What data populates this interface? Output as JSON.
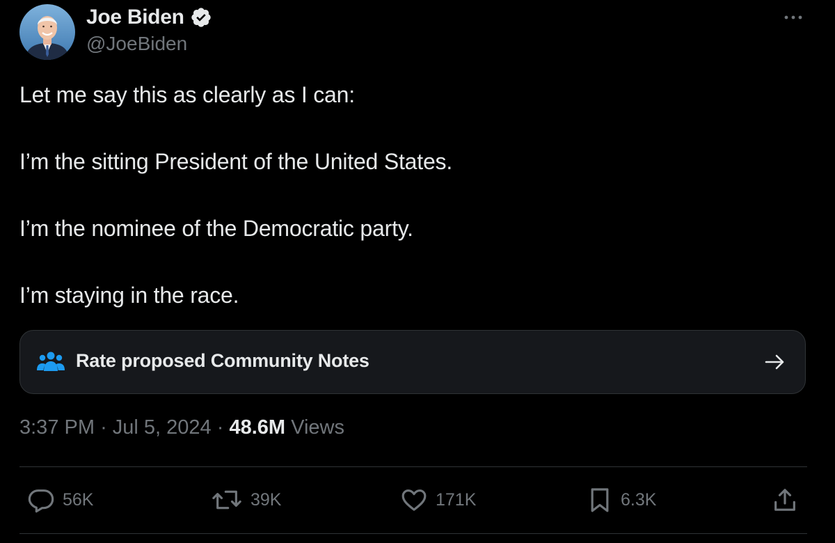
{
  "author": {
    "display_name": "Joe Biden",
    "handle": "@JoeBiden",
    "verified_icon": "verified-badge-icon",
    "avatar_icon": "avatar"
  },
  "tweet": {
    "paragraphs": [
      "Let me say this as clearly as I can:",
      "I’m the sitting President of the United States.",
      "I’m the nominee of the Democratic party.",
      "I’m staying in the race."
    ]
  },
  "community_notes": {
    "label": "Rate proposed Community Notes",
    "icon": "community-notes-icon",
    "arrow_icon": "arrow-right-icon"
  },
  "meta": {
    "time": "3:37 PM",
    "separator": "·",
    "date": "Jul 5, 2024",
    "views_count": "48.6M",
    "views_label": "Views"
  },
  "actions": {
    "replies": "56K",
    "reposts": "39K",
    "likes": "171K",
    "bookmarks": "6.3K"
  },
  "colors": {
    "background": "#000000",
    "text_primary": "#e7e9ea",
    "text_secondary": "#71767b",
    "accent_blue": "#1d9bf0",
    "border": "#2f3336",
    "card_bg": "#16181c"
  }
}
